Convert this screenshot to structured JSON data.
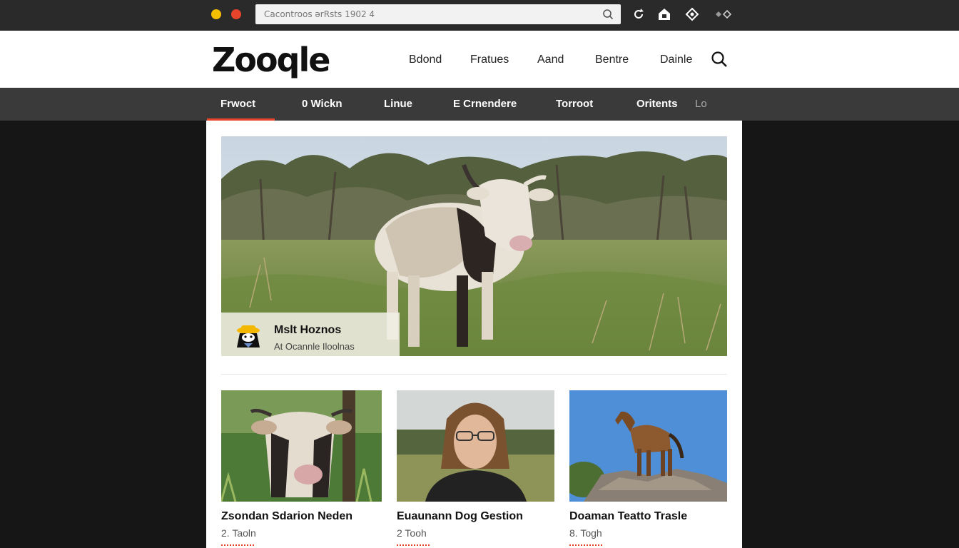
{
  "browser": {
    "url_text": "Cacontroos ərRsts 1902 4",
    "icons": [
      "refresh-icon",
      "home-icon",
      "settings-icon",
      "extensions-icon"
    ]
  },
  "header": {
    "logo": "Zooqle",
    "nav": [
      "Bdond",
      "Fratues",
      "Aand",
      "Bentre",
      "Dainle"
    ]
  },
  "categories": {
    "items": [
      "Frwoct",
      "0 Wickn",
      "Linue",
      "E Crnendere",
      "Torroot",
      "Oritents"
    ],
    "more": "Lo",
    "active_index": 0
  },
  "hero": {
    "caption_title": "Mslt Hoznos",
    "caption_subtitle": "At Ocannle Iloolnas"
  },
  "cards": [
    {
      "title": "Zsondan Sdarion Neden",
      "meta": "2. Taoln"
    },
    {
      "title": "Euaunann Dog Gestion",
      "meta": "2 Tooh"
    },
    {
      "title": "Doaman Teatto Trasle",
      "meta": "8. Togh"
    }
  ],
  "colors": {
    "accent": "#e8432b",
    "nav_bg": "#3a3a3a",
    "chrome_bg": "#2a2a2a",
    "page_bg": "#161616"
  }
}
